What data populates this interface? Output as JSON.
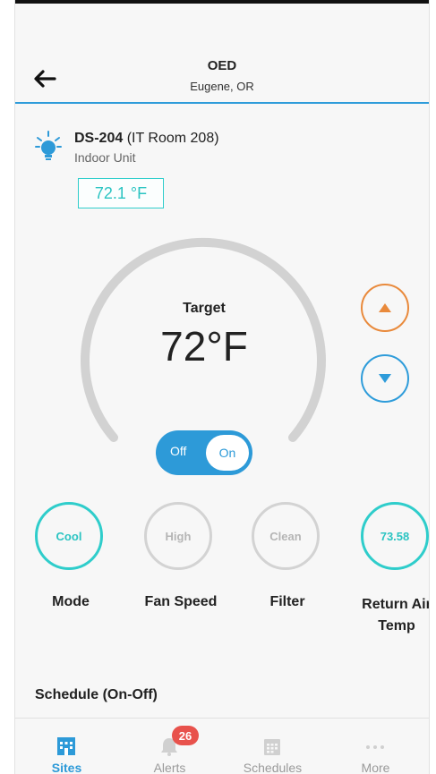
{
  "header": {
    "title": "OED",
    "subtitle": "Eugene, OR"
  },
  "unit": {
    "id": "DS-204",
    "room": " (IT Room 208)",
    "type": "Indoor Unit",
    "current_temp": "72.1 °F"
  },
  "thermostat": {
    "target_label": "Target",
    "target_value": "72°F",
    "power_off_label": "Off",
    "power_on_label": "On"
  },
  "status": [
    {
      "value": "Cool",
      "label": "Mode"
    },
    {
      "value": "High",
      "label": "Fan Speed"
    },
    {
      "value": "Clean",
      "label": "Filter"
    },
    {
      "value": "73.58",
      "label": "Return Air Temp"
    }
  ],
  "schedule": {
    "title": "Schedule (On-Off)"
  },
  "tabs": [
    {
      "label": "Sites",
      "icon": "building-icon",
      "active": true
    },
    {
      "label": "Alerts",
      "icon": "bell-icon",
      "badge": "26"
    },
    {
      "label": "Schedules",
      "icon": "calendar-icon"
    },
    {
      "label": "More",
      "icon": "more-dots-icon"
    }
  ],
  "colors": {
    "primary": "#2d9ad8",
    "teal": "#2fcdcb",
    "orange": "#e98a3c",
    "badge": "#e8524c",
    "inactive": "#d3d3d3"
  }
}
